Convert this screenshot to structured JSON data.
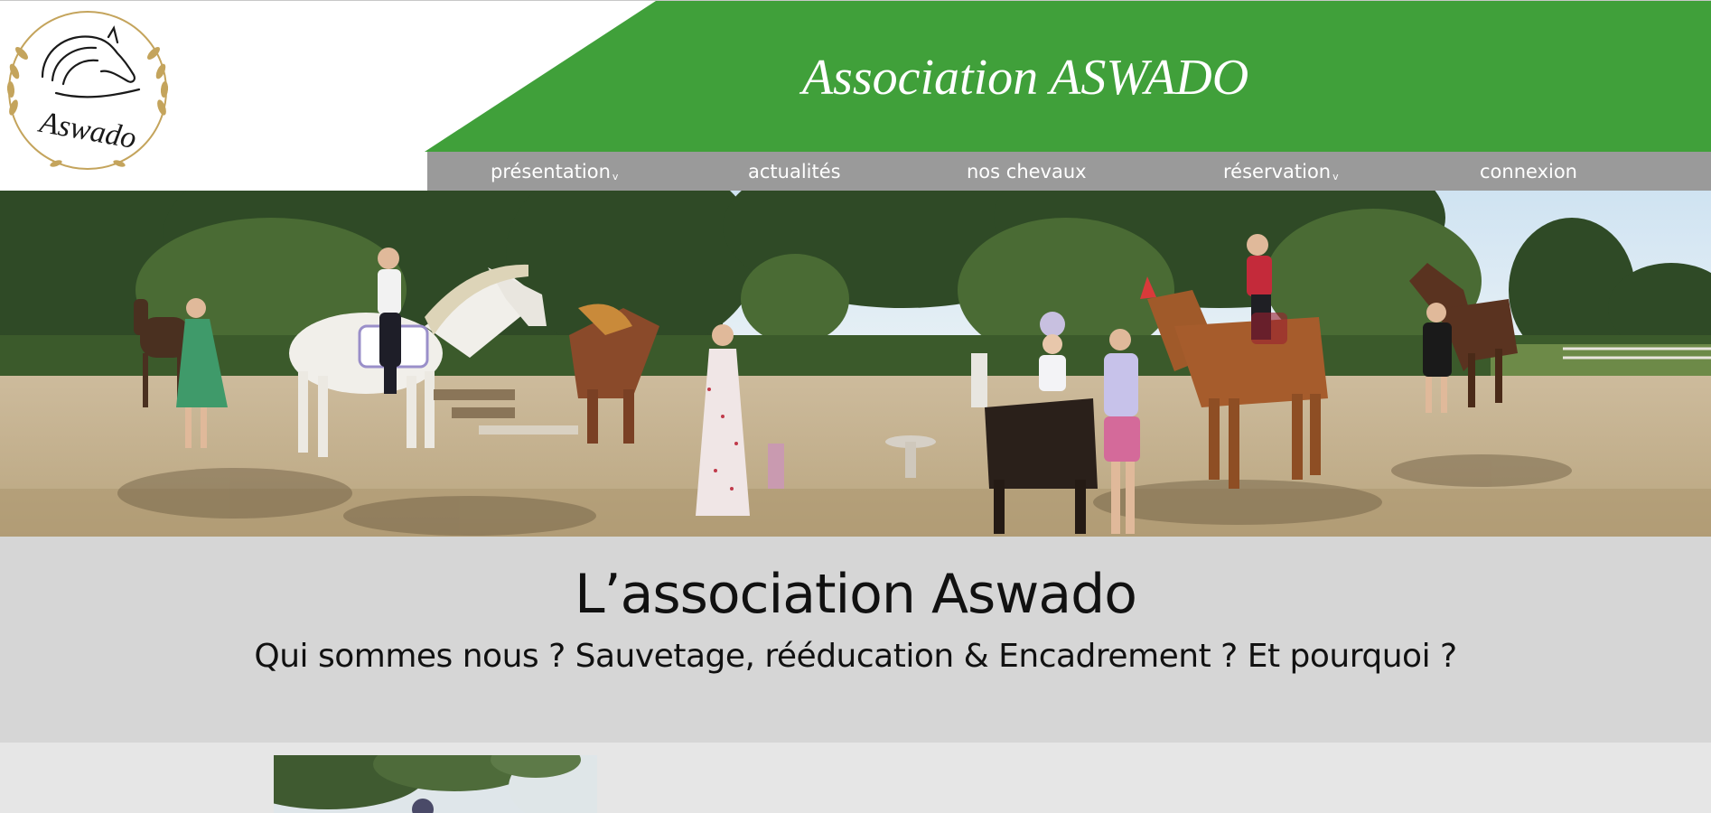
{
  "header": {
    "logo_text": "Aswado",
    "site_title": "Association ASWADO",
    "colors": {
      "banner_green": "#40a03a",
      "nav_gray": "#9a9a9a",
      "logo_gold": "#c4a45c"
    }
  },
  "nav": {
    "items": [
      {
        "label": "présentation",
        "has_dropdown": true
      },
      {
        "label": "actualités",
        "has_dropdown": false
      },
      {
        "label": "nos chevaux",
        "has_dropdown": false
      },
      {
        "label": "réservation",
        "has_dropdown": true
      },
      {
        "label": "connexion",
        "has_dropdown": false
      }
    ],
    "dropdown_caret": "v"
  },
  "hero": {
    "image": "panorama-photo-riders-and-horses"
  },
  "intro": {
    "title": "L’association Aswado",
    "subtitle": "Qui sommes nous ? Sauvetage, rééducation & Encadrement ? Et pourquoi ?"
  },
  "content": {
    "image": "article-thumbnail-photo"
  }
}
